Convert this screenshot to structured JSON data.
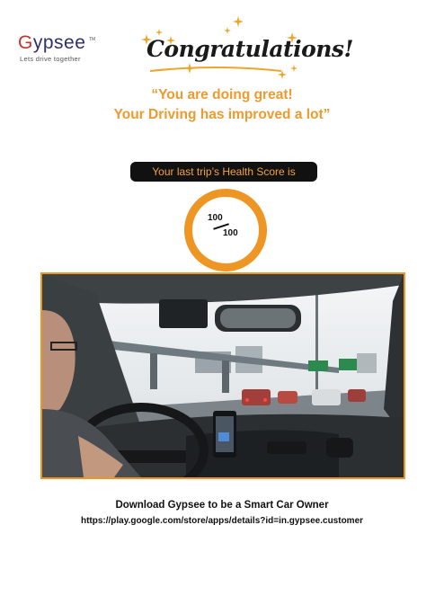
{
  "brand": {
    "initial": "G",
    "rest": "ypsee",
    "trademark": "TM",
    "tagline": "Lets drive together"
  },
  "banner": {
    "heading": "Congratulations!"
  },
  "message": {
    "line1": "“You are doing great!",
    "line2": "Your Driving has improved a lot”"
  },
  "health": {
    "label": "Your last trip’s Health Score is",
    "score": "100",
    "max": "100"
  },
  "download": {
    "title": "Download Gypsee to be a Smart Car Owner",
    "url": "https://play.google.com/store/apps/details?id=in.gypsee.customer"
  },
  "colors": {
    "accent": "#ee9624",
    "brand_red": "#c9322f",
    "brand_navy": "#2f2f6b",
    "pill_bg": "#111111"
  }
}
